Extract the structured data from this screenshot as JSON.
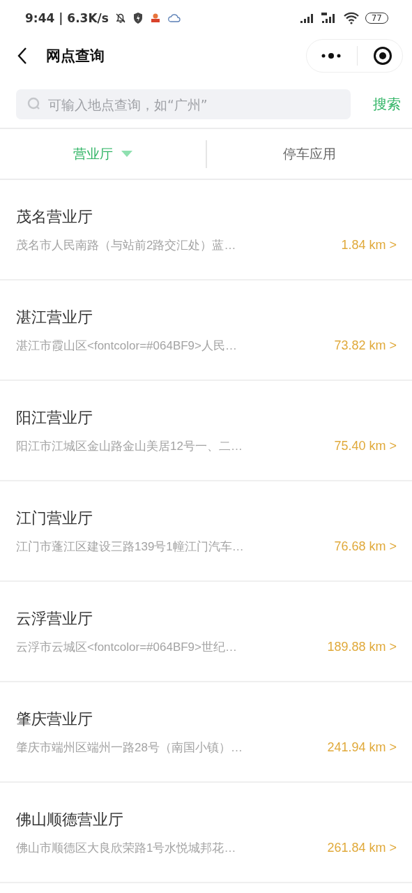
{
  "status_bar": {
    "time": "9:44 | 6.3K/s",
    "battery": "77"
  },
  "nav_bar": {
    "title": "网点查询"
  },
  "search": {
    "placeholder": "可输入地点查询，如“广州”",
    "button": "搜索"
  },
  "tabs": [
    {
      "label": "营业厅",
      "selected": true,
      "dropdown": true
    },
    {
      "label": "停车应用",
      "selected": false,
      "dropdown": false
    }
  ],
  "branches": [
    {
      "name": "茂名营业厅",
      "address": "茂名市人民南路（与站前2路交汇处）蓝…",
      "distance": "1.84 km >"
    },
    {
      "name": "湛江营业厅",
      "address": "湛江市霞山区<fontcolor=#064BF9>人民…",
      "distance": "73.82 km >"
    },
    {
      "name": "阳江营业厅",
      "address": "阳江市江城区金山路金山美居12号一、二…",
      "distance": "75.40 km >"
    },
    {
      "name": "江门营业厅",
      "address": "江门市蓬江区建设三路139号1幢江门汽车…",
      "distance": "76.68 km >"
    },
    {
      "name": "云浮营业厅",
      "address": "云浮市云城区<fontcolor=#064BF9>世纪…",
      "distance": "189.88 km >"
    },
    {
      "name": "肇庆营业厅",
      "address": "肇庆市端州区端州一路28号（南国小镇）…",
      "distance": "241.94 km >"
    },
    {
      "name": "佛山顺德营业厅",
      "address": "佛山市顺德区大良欣荣路1号水悦城邦花…",
      "distance": "261.84 km >"
    }
  ]
}
